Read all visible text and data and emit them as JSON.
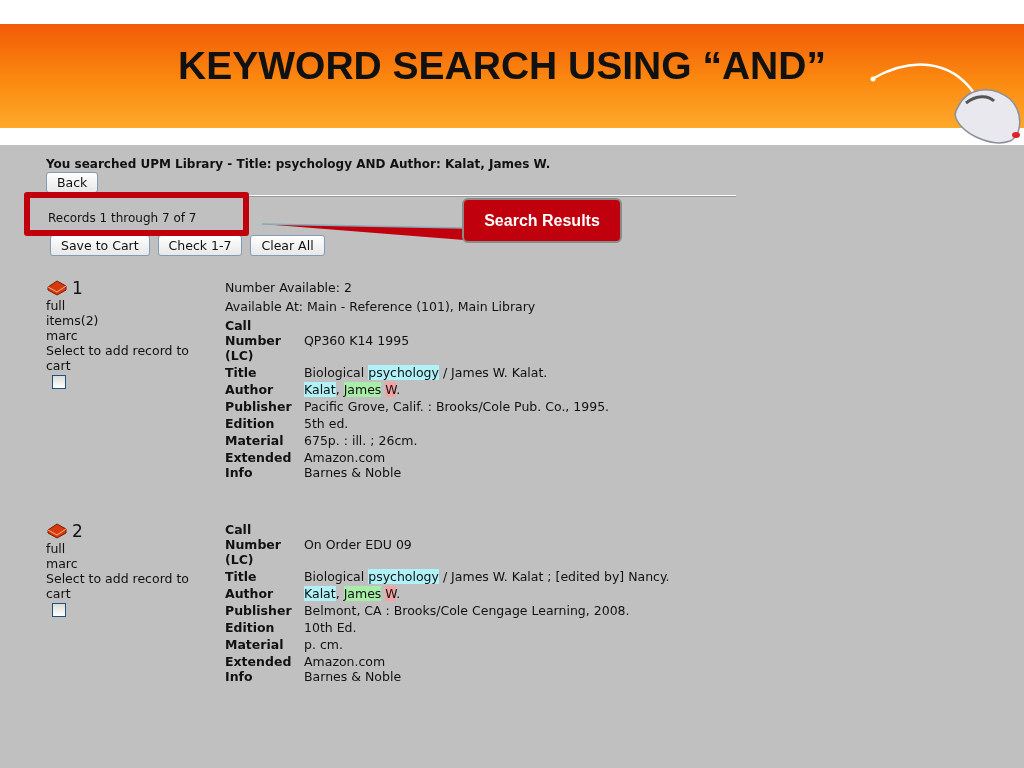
{
  "slide": {
    "title": "KEYWORD SEARCH USING “AND”"
  },
  "callout": {
    "text": "Search Results"
  },
  "search_summary": "You searched UPM Library - Title: psychology AND Author: Kalat, James W.",
  "back_button": "Back",
  "records_count": "Records 1 through 7 of 7",
  "actions": [
    "Save to Cart",
    "Check 1-7",
    "Clear All"
  ],
  "records": [
    {
      "number": "1",
      "links": [
        "full",
        "items(2)",
        "marc"
      ],
      "select_label": "Select to add record to cart",
      "checked": false,
      "availability": [
        "Number Available: 2",
        "Available At: Main - Reference (101), Main Library"
      ],
      "fields": [
        {
          "label": "Call Number (LC)",
          "lines": [
            [
              {
                "text": "QP360 K14 1995"
              }
            ]
          ]
        },
        {
          "label": "Title",
          "lines": [
            [
              {
                "text": "Biological "
              },
              {
                "text": "psychology",
                "color": "#b0f2f8"
              },
              {
                "text": " / James W. Kalat."
              }
            ]
          ]
        },
        {
          "label": "Author",
          "lines": [
            [
              {
                "text": "Kalat",
                "color": "#b0f2f8"
              },
              {
                "text": ", "
              },
              {
                "text": "James",
                "color": "#a8eea8"
              },
              {
                "text": "W",
                "color": "#f2a4a4",
                "space_before": true
              },
              {
                "text": "."
              }
            ]
          ]
        },
        {
          "label": "Publisher",
          "lines": [
            [
              {
                "text": "Pacific Grove, Calif. : Brooks/Cole Pub. Co., 1995."
              }
            ]
          ]
        },
        {
          "label": "Edition",
          "lines": [
            [
              {
                "text": "5th ed."
              }
            ]
          ]
        },
        {
          "label": "Material",
          "lines": [
            [
              {
                "text": "675p. : ill. ; 26cm."
              }
            ]
          ]
        },
        {
          "label": "Extended Info",
          "lines": [
            [
              {
                "text": "Amazon.com"
              }
            ],
            [
              {
                "text": "Barnes & Noble"
              }
            ]
          ]
        }
      ]
    },
    {
      "number": "2",
      "links": [
        "full",
        "marc"
      ],
      "select_label": "Select to add record to cart",
      "checked": false,
      "fields": [
        {
          "label": "Call Number (LC)",
          "lines": [
            [
              {
                "text": "On Order EDU 09"
              }
            ]
          ]
        },
        {
          "label": "Title",
          "lines": [
            [
              {
                "text": "Biological "
              },
              {
                "text": "psychology",
                "color": "#b0f2f8"
              },
              {
                "text": " / James W. Kalat ; [edited by] Nancy."
              }
            ]
          ]
        },
        {
          "label": "Author",
          "lines": [
            [
              {
                "text": "Kalat",
                "color": "#b0f2f8"
              },
              {
                "text": ", "
              },
              {
                "text": "James",
                "color": "#a8eea8"
              },
              {
                "text": "W",
                "color": "#f2a4a4",
                "space_before": true
              },
              {
                "text": "."
              }
            ]
          ]
        },
        {
          "label": "Publisher",
          "lines": [
            [
              {
                "text": "Belmont, CA : Brooks/Cole Cengage Learning, 2008."
              }
            ]
          ]
        },
        {
          "label": "Edition",
          "lines": [
            [
              {
                "text": "10th Ed."
              }
            ]
          ]
        },
        {
          "label": "Material",
          "lines": [
            [
              {
                "text": "p. cm."
              }
            ]
          ]
        },
        {
          "label": "Extended Info",
          "lines": [
            [
              {
                "text": "Amazon.com"
              }
            ],
            [
              {
                "text": "Barnes & Noble"
              }
            ]
          ]
        }
      ]
    }
  ]
}
